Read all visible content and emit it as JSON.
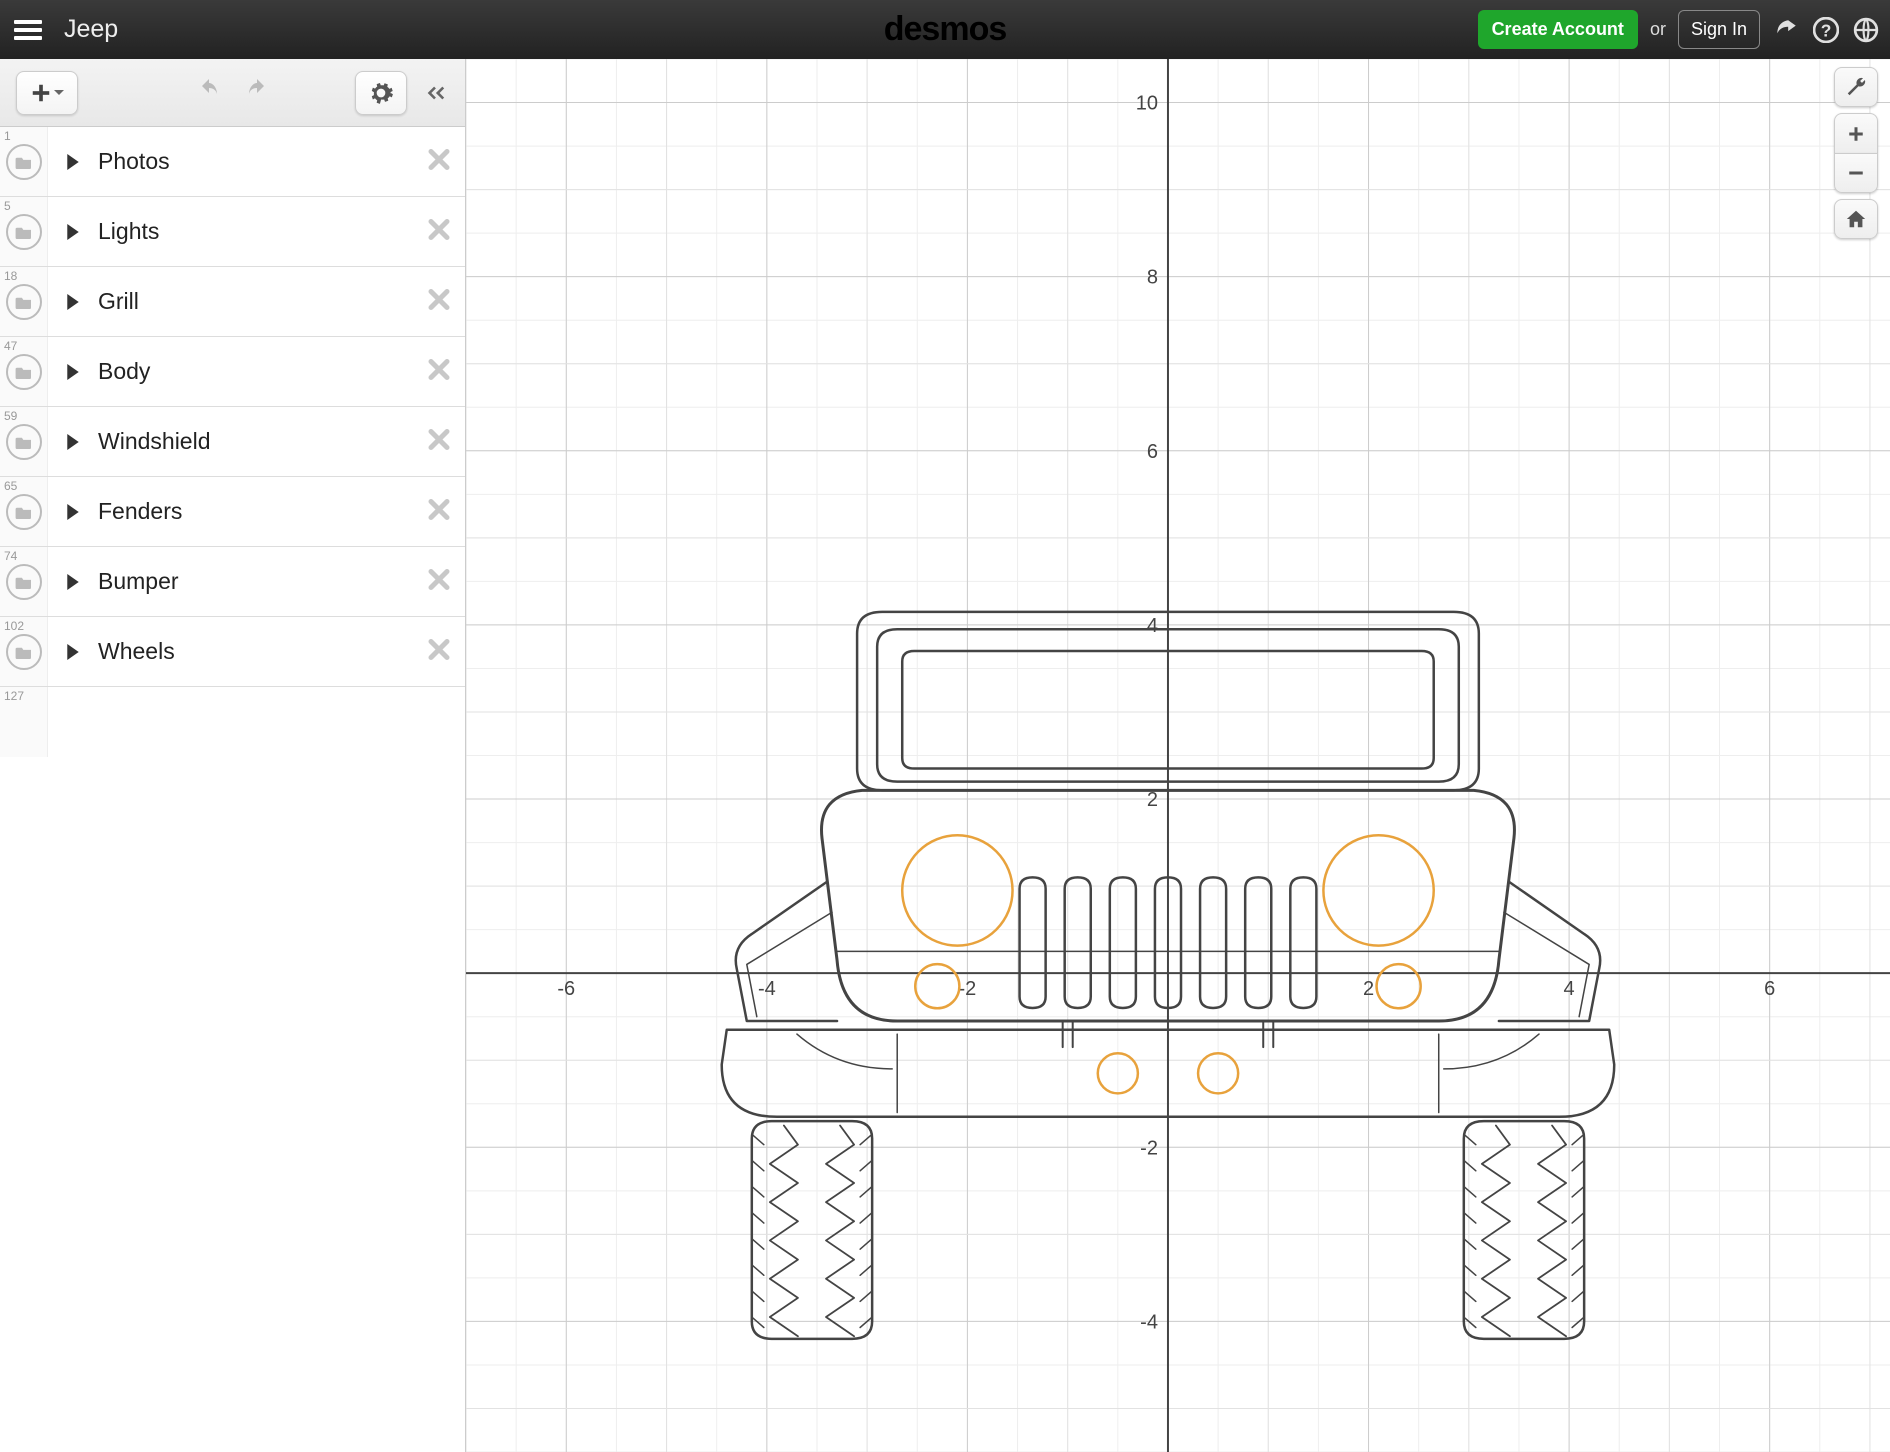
{
  "header": {
    "title": "Jeep",
    "brand": "desmos",
    "create_account": "Create Account",
    "or": "or",
    "sign_in": "Sign In"
  },
  "sidebar": {
    "folders": [
      {
        "num": "1",
        "label": "Photos"
      },
      {
        "num": "5",
        "label": "Lights"
      },
      {
        "num": "18",
        "label": "Grill"
      },
      {
        "num": "47",
        "label": "Body"
      },
      {
        "num": "59",
        "label": "Windshield"
      },
      {
        "num": "65",
        "label": "Fenders"
      },
      {
        "num": "74",
        "label": "Bumper"
      },
      {
        "num": "102",
        "label": "Wheels"
      }
    ],
    "empty_row_num": "127"
  },
  "graph": {
    "x_ticks": [
      "-6",
      "-4",
      "-2",
      "2",
      "4",
      "6"
    ],
    "y_ticks": [
      "-4",
      "-2",
      "2",
      "4",
      "6",
      "8",
      "10"
    ],
    "x_range": [
      -7,
      7.2
    ],
    "y_range": [
      -5.5,
      10.5
    ]
  }
}
